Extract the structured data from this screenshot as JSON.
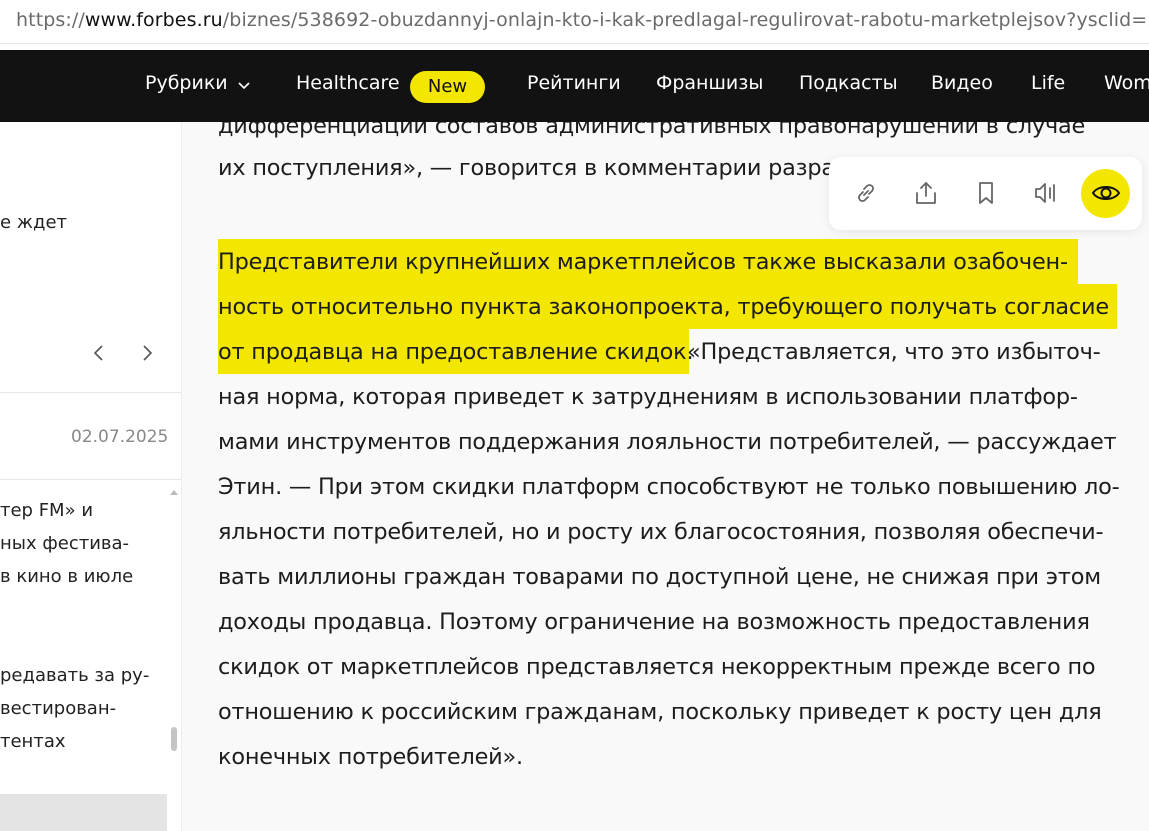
{
  "browser": {
    "url_prefix": "https://",
    "url_domain": "www.forbes.ru",
    "url_path": "/biznes/538692-obuzdannyj-onlajn-kto-i-kak-predlagal-regulirovat-rabotu-marketplejsov?ysclid=mc"
  },
  "nav": {
    "items": [
      {
        "label": "Рубрики"
      },
      {
        "label": "Healthcare"
      },
      {
        "label": "Рейтинги"
      },
      {
        "label": "Франшизы"
      },
      {
        "label": "Подкасты"
      },
      {
        "label": "Видео"
      },
      {
        "label": "Life"
      },
      {
        "label": "Wom"
      }
    ],
    "new_badge": "New"
  },
  "sidebar": {
    "text_top": "е ждет",
    "date": "02.07.2025",
    "story1_lines": [
      "тер FM» и",
      "ных фестива-",
      "в кино в июле"
    ],
    "story2_lines": [
      "редавать за ру-",
      "вестирован-",
      "тентах"
    ]
  },
  "article": {
    "lines": [
      "дифференциации составов административных правонарушений в случае",
      "их поступления», — говорится в комментарии разра",
      "Представители крупнейших маркетплейсов также высказали озабочен-",
      "ность относительно пункта законопроекта, требующего получать согласие",
      "от продавца на предоставление скидок.",
      " «Представляется, что это избыточ-",
      "ная норма, которая приведет к затруднениям в использовании платфор-",
      "мами инструментов поддержания лояльности потребителей, — рассуждает",
      "Этин. — При этом скидки платформ способствуют не только повышению ло-",
      "яльности потребителей, но и росту их благосостояния, позволяя обеспечи-",
      "вать миллионы граждан товарами по доступной цене, не снижая при этом",
      "доходы продавца. Поэтому ограничение на возможность предоставления",
      "скидок от маркетплейсов представляется некорректным прежде всего по",
      "отношению к российским гражданам, поскольку приведет к росту цен для",
      "конечных потребителей»."
    ]
  },
  "toolbar": {
    "icons": [
      "link-icon",
      "share-icon",
      "bookmark-icon",
      "audio-icon",
      "eye-icon"
    ]
  },
  "colors": {
    "accent": "#f3e600",
    "nav_bg": "#121212"
  }
}
